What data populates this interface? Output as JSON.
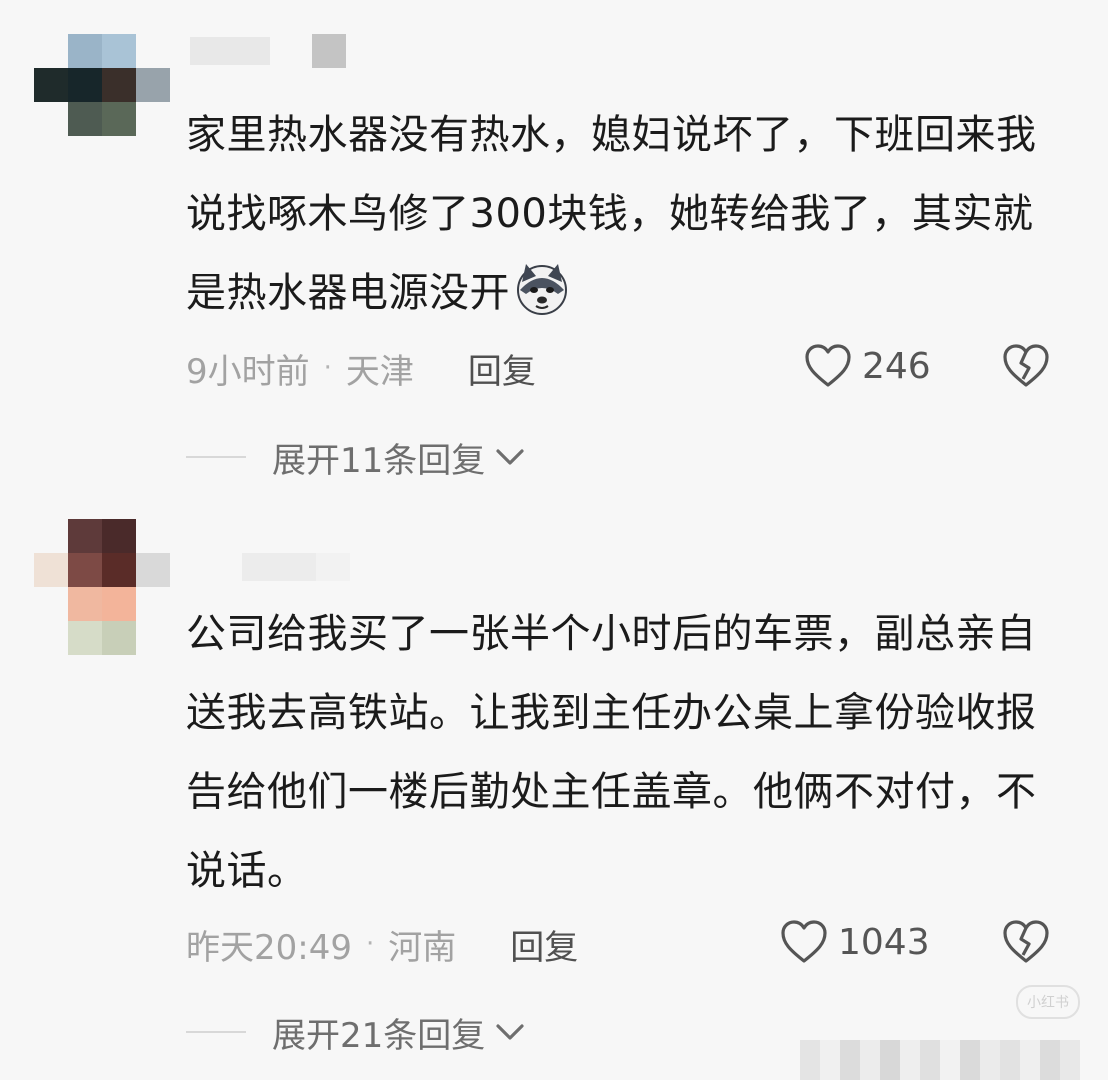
{
  "comments": [
    {
      "text": "家里热水器没有热水，媳妇说坏了，下班回来我说找啄木鸟修了300块钱，她转给我了，其实就是热水器电源没开",
      "time": "9小时前",
      "location": "天津",
      "reply_label": "回复",
      "likes": "246",
      "expand_label": "展开11条回复",
      "emoji": "wolf-face-emoji"
    },
    {
      "text": "公司给我买了一张半个小时后的车票，副总亲自送我去高铁站。让我到主任办公桌上拿份验收报告给他们一楼后勤处主任盖章。他俩不对付，不说话。",
      "time": "昨天20:49",
      "location": "河南",
      "reply_label": "回复",
      "likes": "1043",
      "expand_label": "展开21条回复"
    }
  ],
  "separator": "·",
  "watermark": "小红书",
  "colors": {
    "background": "#f7f7f7",
    "text": "#1b1b1b",
    "meta": "#a2a2a2",
    "icon": "#555555"
  }
}
